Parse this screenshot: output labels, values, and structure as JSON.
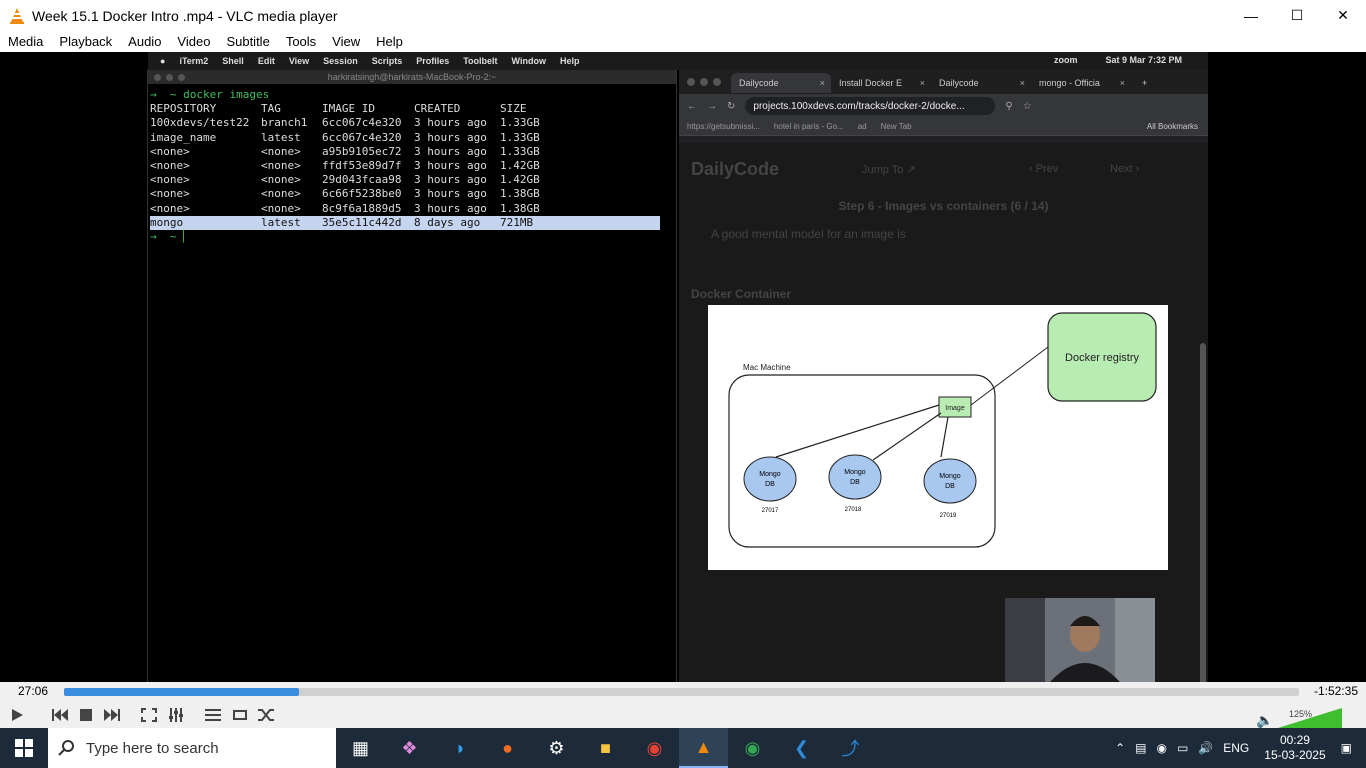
{
  "window": {
    "title": "Week 15.1 Docker Intro .mp4 - VLC media player",
    "minimize": "—",
    "maximize": "☐",
    "close": "✕"
  },
  "menu": [
    "Media",
    "Playback",
    "Audio",
    "Video",
    "Subtitle",
    "Tools",
    "View",
    "Help"
  ],
  "mac": {
    "items": [
      "iTerm2",
      "Shell",
      "Edit",
      "View",
      "Session",
      "Scripts",
      "Profiles",
      "Toolbelt",
      "Window",
      "Help"
    ],
    "zoom": "zoom",
    "datetime": "Sat 9 Mar  7:32 PM"
  },
  "terminal": {
    "title": "harkiratsingh@harkirats-MacBook-Pro-2:~",
    "command": "→  ~ docker images",
    "headers": [
      "REPOSITORY",
      "TAG",
      "IMAGE ID",
      "CREATED",
      "SIZE"
    ],
    "rows": [
      [
        "100xdevs/test22",
        "branch1",
        "6cc067c4e320",
        "3 hours ago",
        "1.33GB"
      ],
      [
        "image_name",
        "latest",
        "6cc067c4e320",
        "3 hours ago",
        "1.33GB"
      ],
      [
        "<none>",
        "<none>",
        "a95b9105ec72",
        "3 hours ago",
        "1.33GB"
      ],
      [
        "<none>",
        "<none>",
        "ffdf53e89d7f",
        "3 hours ago",
        "1.42GB"
      ],
      [
        "<none>",
        "<none>",
        "29d043fcaa98",
        "3 hours ago",
        "1.42GB"
      ],
      [
        "<none>",
        "<none>",
        "6c66f5238be0",
        "3 hours ago",
        "1.38GB"
      ],
      [
        "<none>",
        "<none>",
        "8c9f6a1889d5",
        "3 hours ago",
        "1.38GB"
      ],
      [
        "mongo",
        "latest",
        "35e5c11c442d",
        "8 days ago",
        "721MB"
      ]
    ],
    "prompt": "→  ~ ▏"
  },
  "browser": {
    "tabs": [
      {
        "label": "Dailycode",
        "close": "×"
      },
      {
        "label": "Install Docker E",
        "close": "×"
      },
      {
        "label": "Dailycode",
        "close": "×"
      },
      {
        "label": "mongo - Officia",
        "close": "×"
      }
    ],
    "new_tab": "+",
    "url": "projects.100xdevs.com/tracks/docker-2/docke...",
    "bookmarks": [
      "https://getsubmissi...",
      "hotel in paris - Go...",
      "ad",
      "New Tab"
    ],
    "all_bookmarks": "All Bookmarks",
    "page": {
      "brand": "DailyCode",
      "jump": "Jump To ↗",
      "prev": "‹  Prev",
      "next": "Next  ›",
      "step": "Step 6 - Images vs containers (6 / 14)",
      "hint": "A good mental model for an image is",
      "section": "Docker Container"
    }
  },
  "diagram": {
    "machine": "Mac Machine",
    "image": "Image",
    "registry": "Docker registry",
    "dbs": [
      {
        "name": "Mongo",
        "sub": "DB",
        "port": "27017"
      },
      {
        "name": "Mongo",
        "sub": "DB",
        "port": "27018"
      },
      {
        "name": "Mongo",
        "sub": "DB",
        "port": "27019"
      }
    ]
  },
  "player": {
    "elapsed": "27:06",
    "remaining": "-1:52:35",
    "progress": 0.19,
    "volume": "125%",
    "volume_level": 1.25
  },
  "taskbar": {
    "search_placeholder": "Type here to search",
    "lang": "ENG",
    "time": "00:29",
    "date": "15-03-2025"
  }
}
